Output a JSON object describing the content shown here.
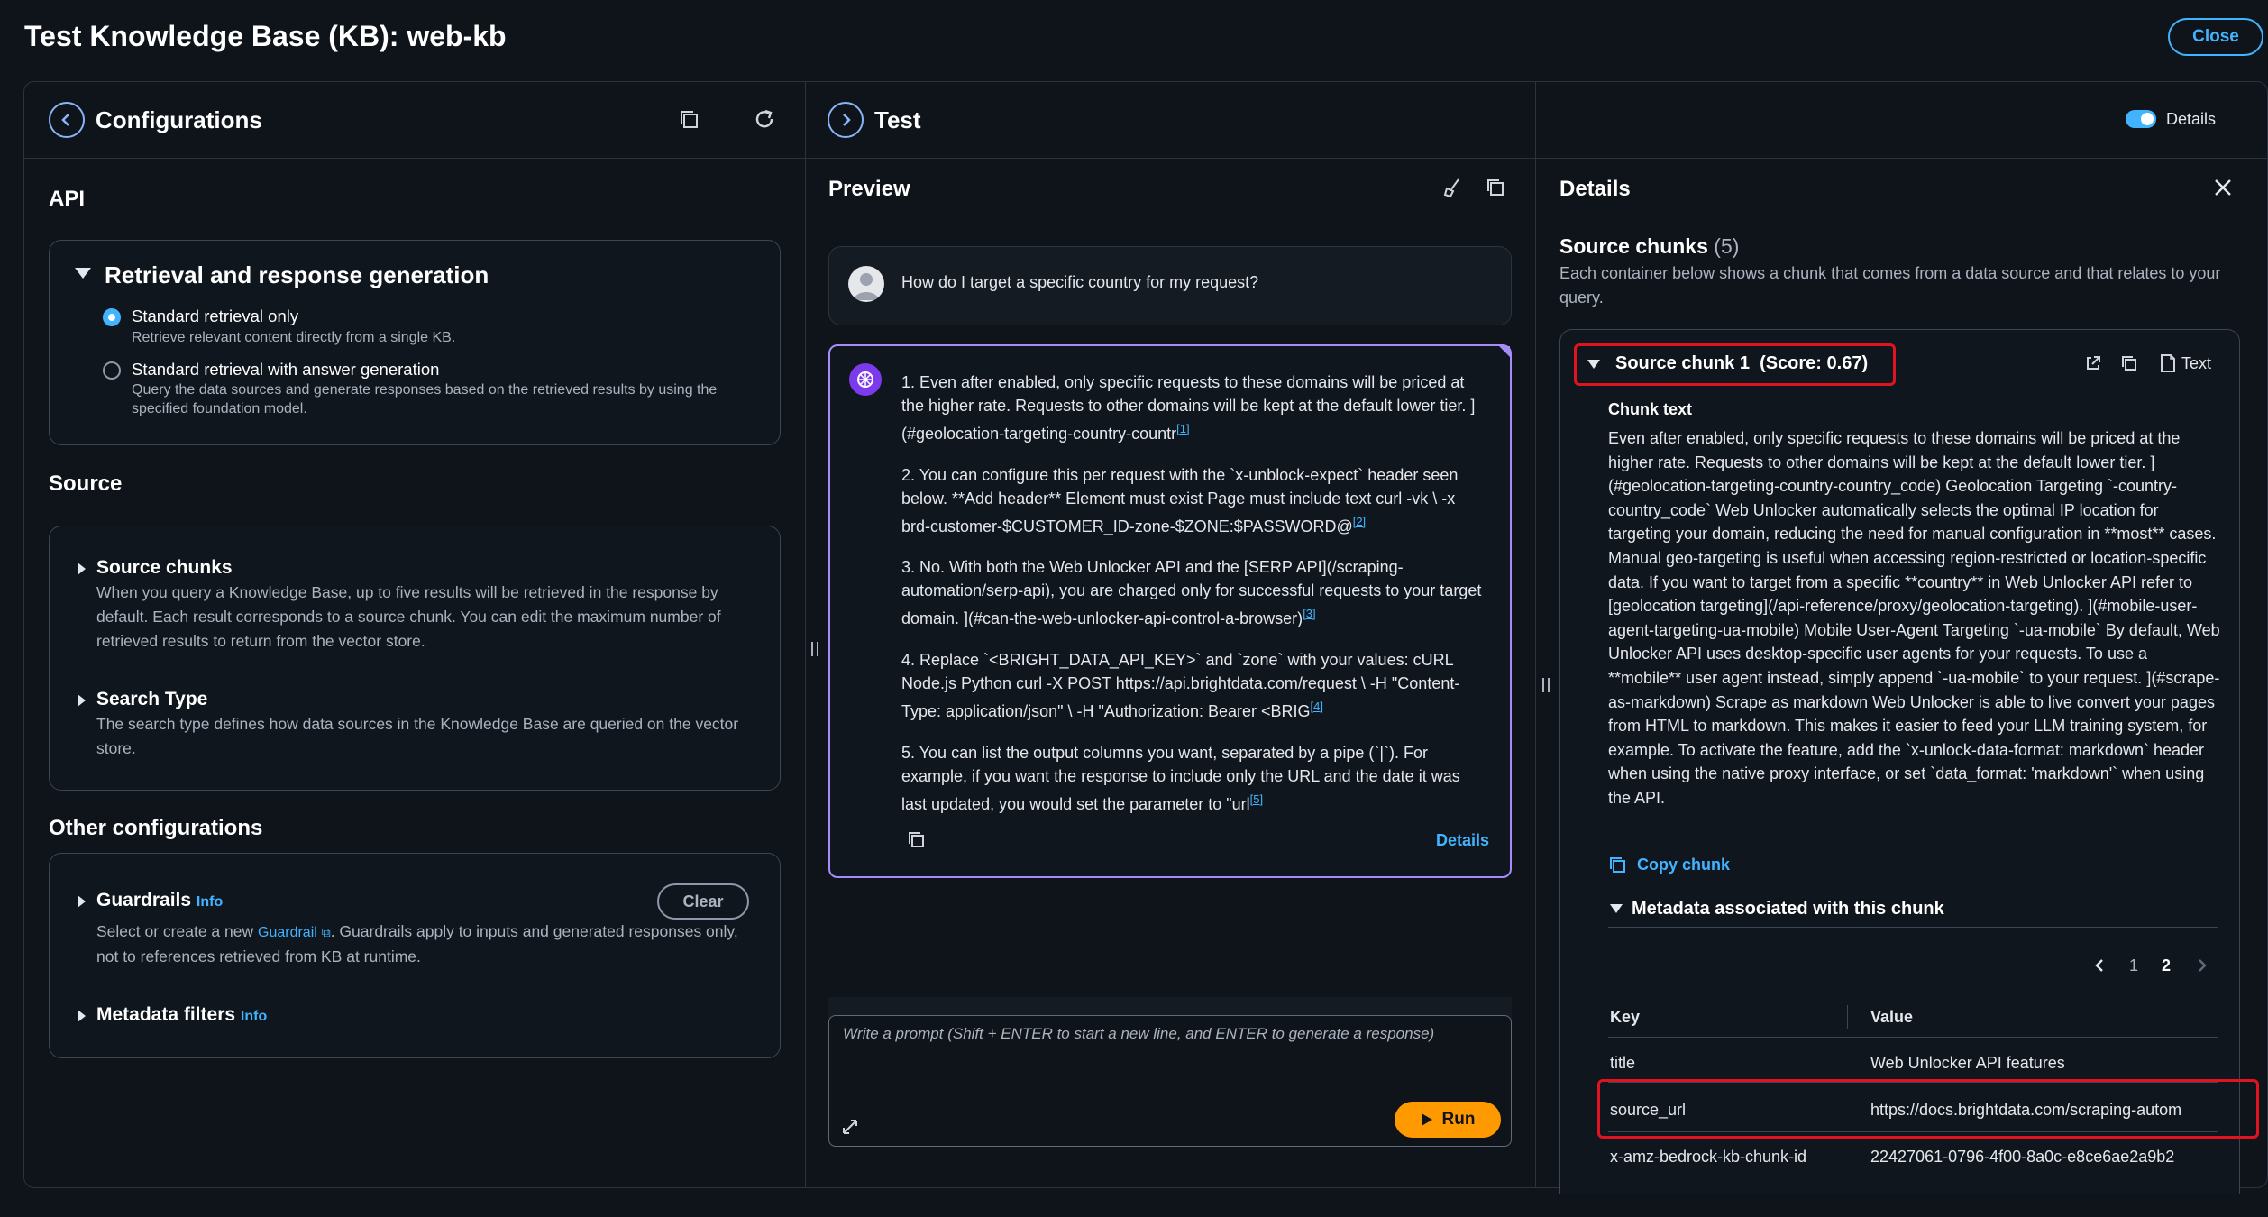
{
  "page": {
    "title": "Test Knowledge Base (KB): web-kb",
    "close_label": "Close"
  },
  "config_panel": {
    "title": "Configurations",
    "api_heading": "API",
    "retrieval": {
      "title": "Retrieval and response generation",
      "options": [
        {
          "label": "Standard retrieval only",
          "description": "Retrieve relevant content directly from a single KB.",
          "selected": true
        },
        {
          "label": "Standard retrieval with answer generation",
          "description": "Query the data sources and generate responses based on the retrieved results by using the specified foundation model.",
          "selected": false
        }
      ]
    },
    "source_heading": "Source",
    "source_items": [
      {
        "title": "Source chunks",
        "description": "When you query a Knowledge Base, up to five results will be retrieved in the response by default. Each result corresponds to a source chunk. You can edit the maximum number of retrieved results to return from the vector store."
      },
      {
        "title": "Search Type",
        "description": "The search type defines how data sources in the Knowledge Base are queried on the vector store."
      }
    ],
    "other_heading": "Other configurations",
    "guardrails": {
      "title": "Guardrails",
      "info": "Info",
      "clear_label": "Clear",
      "desc_before": "Select or create a new",
      "desc_link": "Guardrail",
      "desc_after": ". Guardrails apply to inputs and generated responses only, not to references retrieved from KB at runtime."
    },
    "metadata_filters": {
      "title": "Metadata filters",
      "info": "Info"
    }
  },
  "test_panel": {
    "title": "Test",
    "details_toggle_label": "Details",
    "details_toggle_on": true,
    "preview_title": "Preview",
    "user_query": "How do I target a specific country for my request?",
    "answer": [
      {
        "text": "1. Even after enabled, only specific requests to these domains will be priced at the higher rate. Requests to other domains will be kept at the default lower tier. ](#geolocation-targeting-country-countr",
        "cite": "[1]"
      },
      {
        "text": "2. You can configure this per request with the `x-unblock-expect` header seen below. **Add header** Element must exist Page must include text curl -vk \\ -x brd-customer-$CUSTOMER_ID-zone-$ZONE:$PASSWORD@",
        "cite": "[2]"
      },
      {
        "text": "3. No. With both the Web Unlocker API and the [SERP API](/scraping-automation/serp-api), you are charged only for successful requests to your target domain. ](#can-the-web-unlocker-api-control-a-browser)",
        "cite": "[3]"
      },
      {
        "text": "4. Replace `<BRIGHT_DATA_API_KEY>` and `zone` with your values: cURL Node.js Python curl -X POST https://api.brightdata.com/request \\ -H \"Content-Type: application/json\" \\ -H \"Authorization: Bearer <BRIG",
        "cite": "[4]"
      },
      {
        "text": "5. You can list the output columns you want, separated by a pipe (`|`). For example, if you want the response to include only the URL and the date it was last updated, you would set the parameter to \"url",
        "cite": "[5]"
      }
    ],
    "answer_details_link": "Details",
    "prompt_placeholder": "Write a prompt (Shift + ENTER to start a new line, and ENTER to generate a response)",
    "run_label": "Run"
  },
  "details_panel": {
    "title": "Details",
    "source_chunks_label": "Source chunks",
    "source_chunks_count": "(5)",
    "source_chunks_desc": "Each container below shows a chunk that comes from a data source and that relates to your query.",
    "chunk": {
      "title": "Source chunk 1",
      "score": "(Score: 0.67)",
      "text_btn": "Text",
      "chunk_text_heading": "Chunk text",
      "chunk_text": "Even after enabled, only specific requests to these domains will be priced at the higher rate. Requests to other domains will be kept at the default lower tier. ](#geolocation-targeting-country-country_code) Geolocation Targeting `-country-country_code` Web Unlocker automatically selects the optimal IP location for targeting your domain, reducing the need for manual configuration in **most** cases. Manual geo-targeting is useful when accessing region-restricted or location-specific data. If you want to target from a specific **country** in Web Unlocker API refer to [geolocation targeting](/api-reference/proxy/geolocation-targeting). ](#mobile-user-agent-targeting-ua-mobile) Mobile User-Agent Targeting `-ua-mobile` By default, Web Unlocker API uses desktop-specific user agents for your requests. To use a **mobile** user agent instead, simply append `-ua-mobile` to your request. ](#scrape-as-markdown) Scrape as markdown Web Unlocker is able to live convert your pages from HTML to markdown. This makes it easier to feed your LLM training system, for example. To activate the feature, add the `x-unlock-data-format: markdown` header when using the native proxy interface, or set `data_format: 'markdown'` when using the API.",
      "copy_label": "Copy chunk",
      "metadata_heading": "Metadata associated with this chunk",
      "pagination": {
        "pages": [
          "1",
          "2"
        ],
        "current": "2"
      },
      "table": {
        "headers": [
          "Key",
          "Value"
        ],
        "rows": [
          [
            "title",
            "Web Unlocker API features"
          ],
          [
            "source_url",
            "https://docs.brightdata.com/scraping-autom"
          ],
          [
            "x-amz-bedrock-kb-chunk-id",
            "22427061-0796-4f00-8a0c-e8ce6ae2a9b2"
          ]
        ]
      }
    }
  },
  "colors": {
    "background": "#0f141a",
    "accent": "#42b4ff",
    "run_button": "#ff9900",
    "highlight_box": "#e0141e",
    "answer_border": "#a78bfa"
  }
}
